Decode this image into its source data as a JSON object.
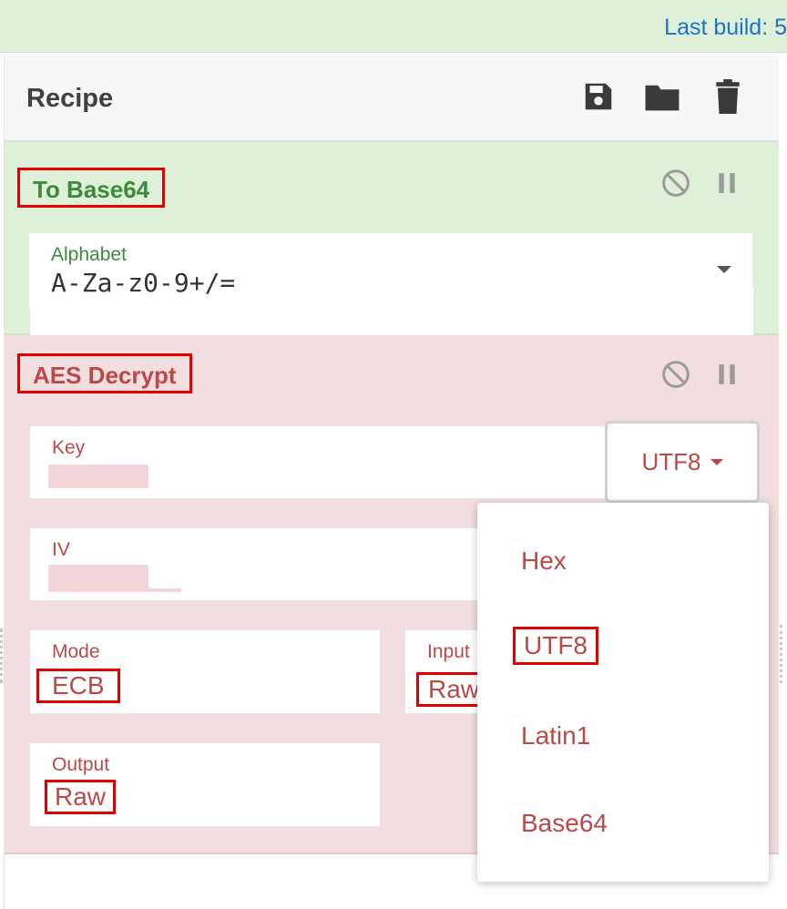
{
  "topbar": {
    "last_build": "Last build: 5"
  },
  "recipe": {
    "title": "Recipe",
    "icons": [
      "save-icon",
      "folder-icon",
      "trash-icon"
    ]
  },
  "operations": [
    {
      "name": "To Base64",
      "fields": [
        {
          "label": "Alphabet",
          "value": "A-Za-z0-9+/="
        }
      ]
    },
    {
      "name": "AES Decrypt",
      "fields": {
        "key_label": "Key",
        "key_encoding": "UTF8",
        "iv_label": "IV",
        "mode_label": "Mode",
        "mode_value": "ECB",
        "input_label": "Input",
        "input_value": "Raw",
        "output_label": "Output",
        "output_value": "Raw"
      }
    }
  ],
  "encoding_dropdown": {
    "options": [
      "Hex",
      "UTF8",
      "Latin1",
      "Base64"
    ],
    "highlighted": "UTF8"
  },
  "colors": {
    "green_op": "#dff0d8",
    "red_op": "#f2dede",
    "green_text": "#3c8a3c",
    "red_text": "#b94a48",
    "annotation": "#e00000"
  }
}
